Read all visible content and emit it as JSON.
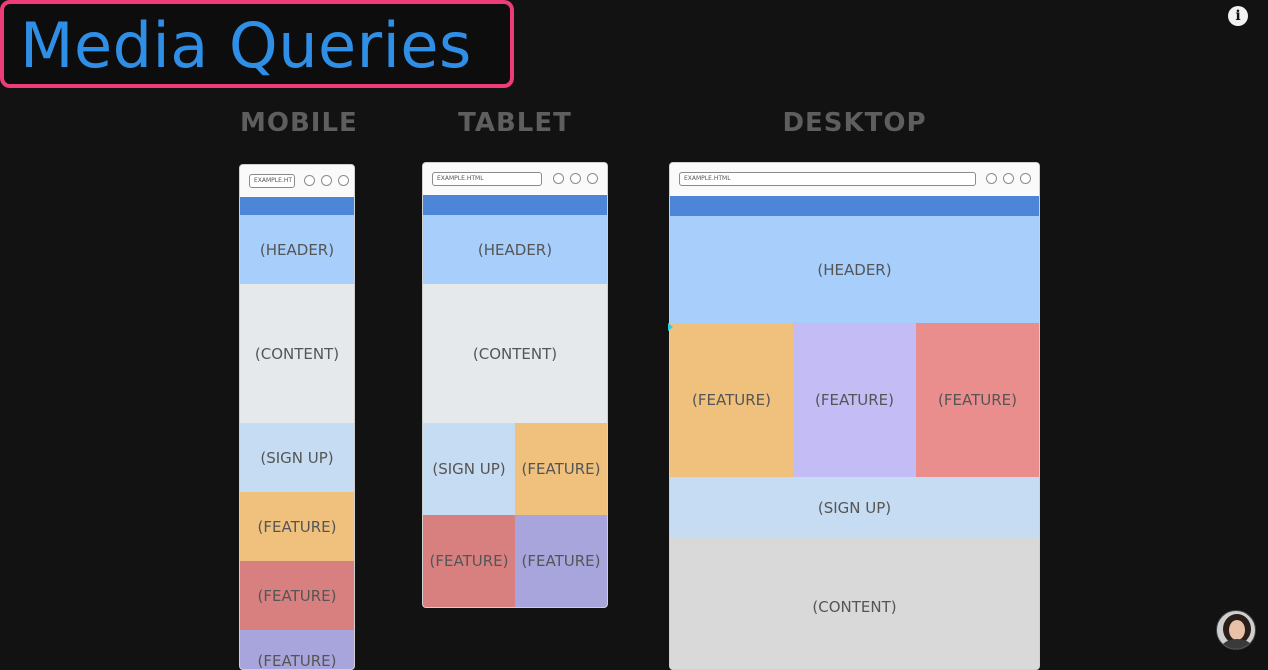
{
  "title": "Media Queries",
  "info_icon": "info-icon",
  "columns": {
    "mobile": "MOBILE",
    "tablet": "TABLET",
    "desktop": "DESKTOP"
  },
  "mobile": {
    "url": "EXAMPLE.HT",
    "blocks": [
      "(HEADER)",
      "(CONTENT)",
      "(SIGN UP)",
      "(FEATURE)",
      "(FEATURE)",
      "(FEATURE)"
    ]
  },
  "tablet": {
    "url": "EXAMPLE.HTML",
    "blocks": [
      "(HEADER)",
      "(CONTENT)",
      "(SIGN UP)",
      "(FEATURE)",
      "(FEATURE)",
      "(FEATURE)"
    ]
  },
  "desktop": {
    "url": "EXAMPLE.HTML",
    "blocks": [
      "(HEADER)",
      "(FEATURE)",
      "(FEATURE)",
      "(FEATURE)",
      "(SIGN UP)",
      "(CONTENT)"
    ]
  },
  "colors": {
    "title": "#2f8fe6",
    "title_border": "#ee3c79",
    "nav": "#4d86d6",
    "header": "#a8cefc",
    "content": "#e6e9ec",
    "signup": "#c6dcf2",
    "feature_orange": "#efc17d",
    "feature_red": "#d88080",
    "feature_purple": "#a8a5dc"
  }
}
